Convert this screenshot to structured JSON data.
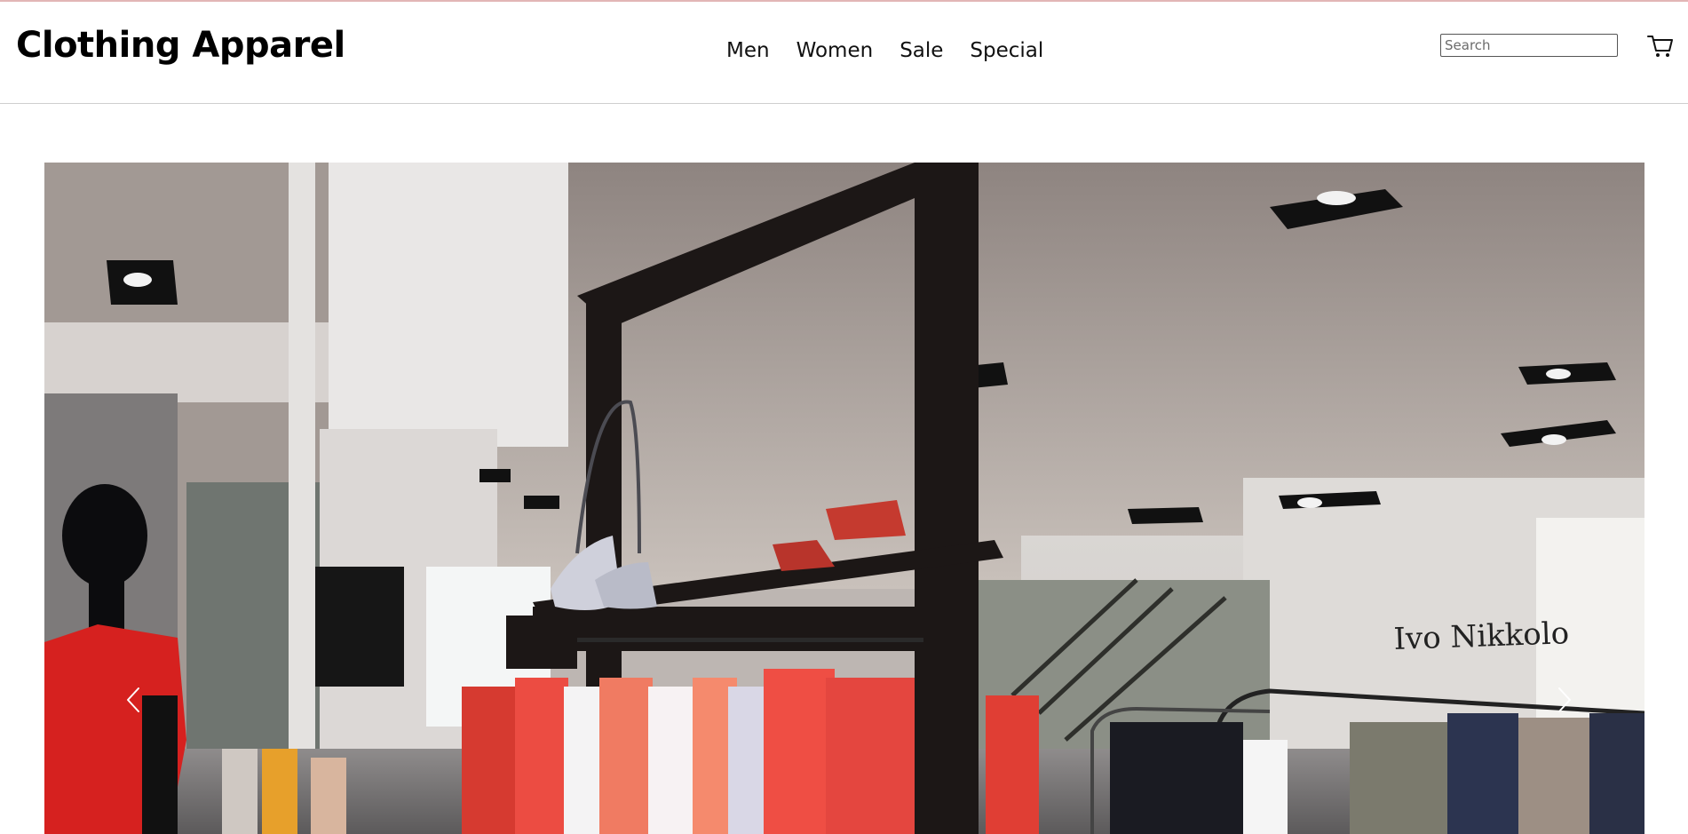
{
  "header": {
    "brand": "Clothing Apparel",
    "nav": [
      {
        "label": "Men"
      },
      {
        "label": "Women"
      },
      {
        "label": "Sale"
      },
      {
        "label": "Special"
      }
    ],
    "search": {
      "placeholder": "Search",
      "value": ""
    },
    "cart_icon": "cart-icon"
  },
  "carousel": {
    "prev_icon": "chevron-left-icon",
    "next_icon": "chevron-right-icon",
    "slide": {
      "store_sign": "Ivo Nikkolo"
    }
  },
  "colors": {
    "accent_top_line": "#e2b6b6",
    "text": "#111111"
  }
}
